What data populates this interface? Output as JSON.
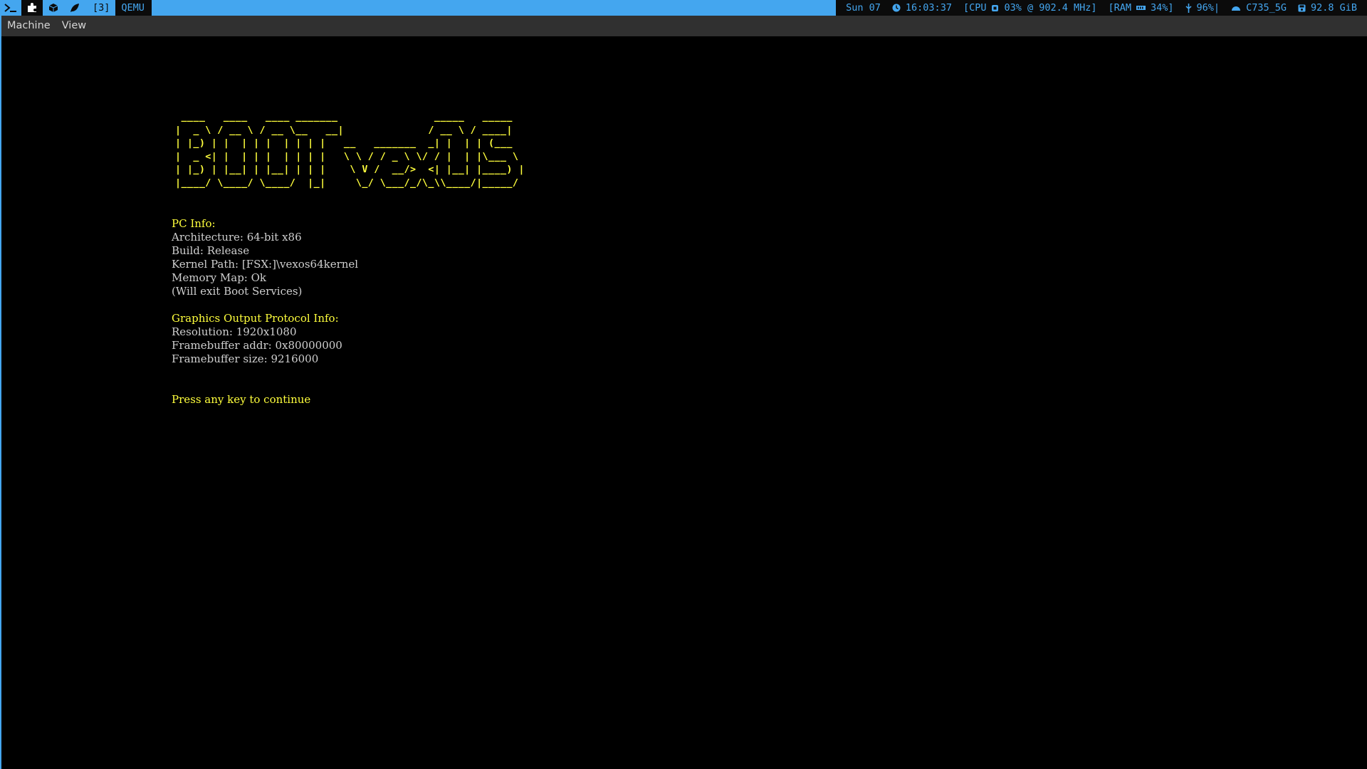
{
  "topbar": {
    "workspace_number": "[3]",
    "window_title": "QEMU",
    "date": "Sun 07",
    "time": "16:03:37",
    "cpu": "[CPU",
    "cpu_value": "03% @ 902.4 MHz]",
    "ram": "[RAM",
    "ram_value": "34%]",
    "battery": "96%|",
    "wifi": "C735_5G",
    "disk": "92.8 GiB",
    "icons": {
      "terminal": "terminal-icon",
      "puzzle": "puzzle-icon",
      "cube": "cube-icon",
      "leaf": "leaf-icon",
      "clock": "clock-icon",
      "cpu": "cpu-icon",
      "ram": "memory-icon",
      "battery": "battery-icon",
      "wifi": "wifi-icon",
      "disk": "disk-icon"
    },
    "colors": {
      "bar": "#44a6ef",
      "dark": "#0b0b0b"
    }
  },
  "menubar": {
    "items": [
      "Machine",
      "View"
    ]
  },
  "console": {
    "logo_lines": [
      " ____   ____   ____ _______                _____   _____ ",
      "|  _ \\ / __ \\ / __ \\__   __|              / __ \\ / ____|",
      "| |_) | |  | | |  | | | |   __   _______  _| |  | | (___  ",
      "|  _ <| |  | | |  | | | |   \\ \\ / / _ \\ \\/ / |  | |\\___ \\ ",
      "| |_) | |__| | |__| | | |    \\ V /  __/>  <| |__| |____) |",
      "|____/ \\____/ \\____/  |_|     \\_/ \\___/_/\\_\\\\____/|_____/ "
    ],
    "pc_info_header": "PC Info:",
    "architecture": "Architecture: 64-bit x86",
    "build": "Build: Release",
    "kernel_path": "Kernel Path: [FSX:]\\vexos64kernel",
    "memory_map": "Memory Map: Ok",
    "boot_services": "(Will exit Boot Services)",
    "gop_header": "Graphics Output Protocol Info:",
    "resolution": "Resolution: 1920x1080",
    "fb_addr": "Framebuffer addr: 0x80000000",
    "fb_size": "Framebuffer size: 9216000",
    "prompt": "Press any key to continue",
    "colors": {
      "text": "#cfcfcf",
      "highlight": "#ffff3c"
    }
  }
}
